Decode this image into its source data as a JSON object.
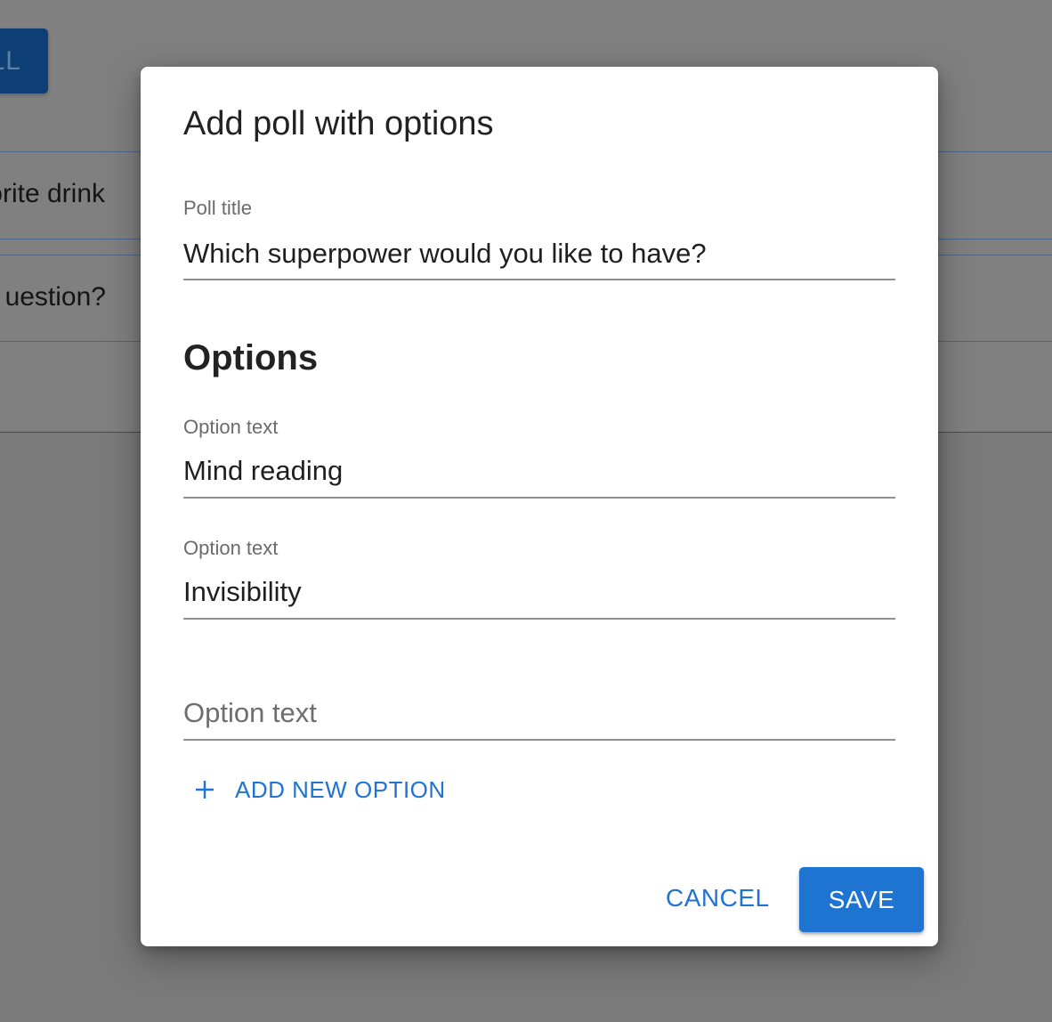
{
  "background": {
    "add_button_label": "LL",
    "rows": [
      {
        "text": "avorite drink"
      },
      {
        "text": "uestion?"
      }
    ]
  },
  "dialog": {
    "title": "Add poll with options",
    "poll_title": {
      "label": "Poll title",
      "value": "Which superpower would you like to have?"
    },
    "options_heading": "Options",
    "options": [
      {
        "label": "Option text",
        "value": "Mind reading"
      },
      {
        "label": "Option text",
        "value": "Invisibility"
      },
      {
        "label": "",
        "value": "",
        "placeholder": "Option text"
      }
    ],
    "add_option_label": "ADD NEW OPTION",
    "add_option_icon": "plus-icon",
    "cancel_label": "CANCEL",
    "save_label": "SAVE"
  },
  "colors": {
    "primary": "#1f74d2",
    "overlay": "#7f7f7f",
    "text": "#222222",
    "label": "#6b6b6b"
  }
}
